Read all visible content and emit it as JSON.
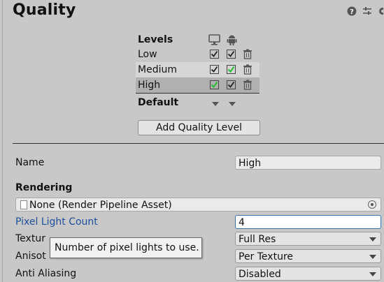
{
  "header": {
    "title": "Quality"
  },
  "levels": {
    "label": "Levels",
    "rows": [
      {
        "name": "Low"
      },
      {
        "name": "Medium"
      },
      {
        "name": "High"
      }
    ],
    "default_label": "Default"
  },
  "add_button_label": "Add Quality Level",
  "props": {
    "name_label": "Name",
    "name_value": "High",
    "rendering_label": "Rendering",
    "pipeline_value": "None (Render Pipeline Asset)",
    "pixel_light_label": "Pixel Light Count",
    "pixel_light_value": "4",
    "texture_label": "Textur",
    "texture_value": "Full Res",
    "aniso_label": "Anisot",
    "aniso_value": "Per Texture",
    "aa_label": "Anti Aliasing",
    "aa_value": "Disabled"
  },
  "tooltip": {
    "text": "Number of pixel lights to use."
  },
  "colors": {
    "check_green": "#2fbf3a",
    "accent_blue": "#1f4f9c"
  }
}
